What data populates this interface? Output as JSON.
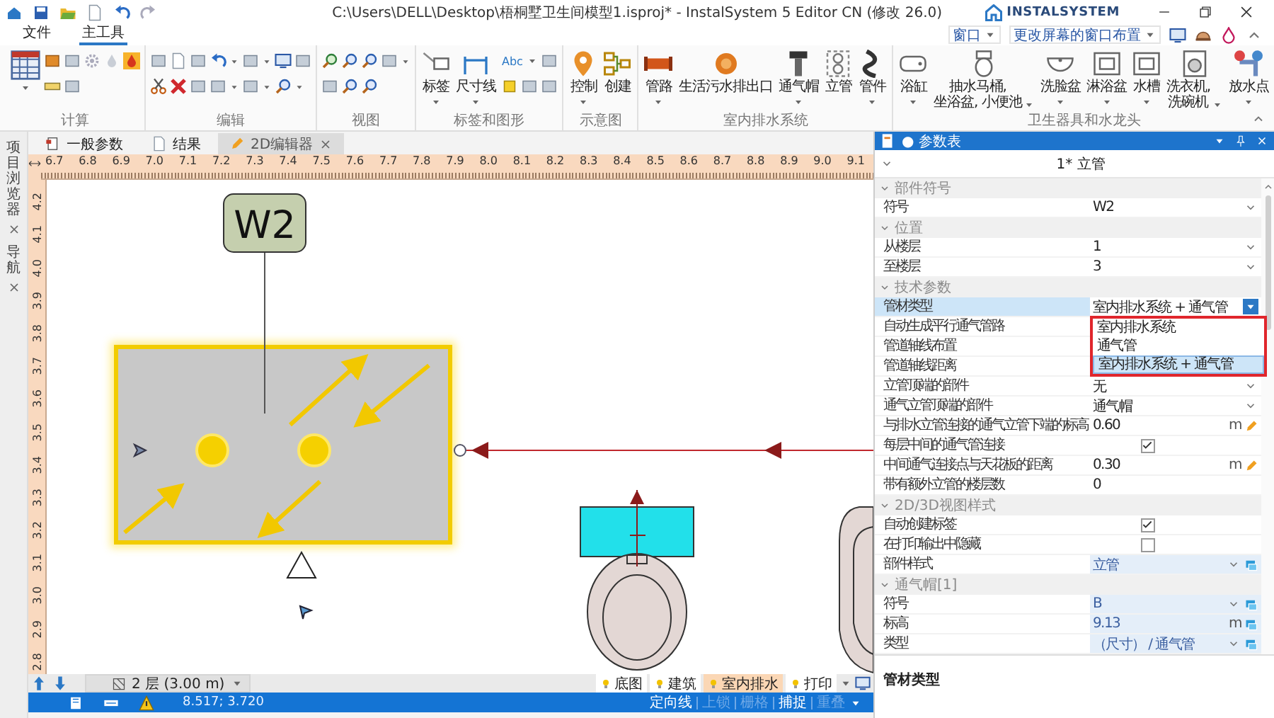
{
  "window": {
    "title": "C:\\Users\\DELL\\Desktop\\梧桐墅卫生间模型1.isproj* - InstalSystem 5 Editor CN (修改 26.0)",
    "logo": "INSTALSYSTEM"
  },
  "ribbon_tabs": [
    {
      "label": "文件",
      "selected": false
    },
    {
      "label": "主工具",
      "selected": true
    }
  ],
  "ribbon_right": [
    "窗口",
    "更改屏幕的窗口布置"
  ],
  "ribbon_groups": [
    {
      "label": "计算"
    },
    {
      "label": "编辑"
    },
    {
      "label": "视图"
    },
    {
      "label": "标签和图形",
      "text_tool": "Abc",
      "buttons": [
        {
          "label": "标签",
          "menu": true
        },
        {
          "label": "尺寸线",
          "menu": true
        }
      ]
    },
    {
      "label": "示意图",
      "buttons": [
        {
          "label": "控制",
          "menu": true
        },
        {
          "label": "创建",
          "menu": false
        }
      ]
    },
    {
      "label": "室内排水系统",
      "buttons": [
        {
          "label": "管路",
          "menu": true
        },
        {
          "label": "生活污水排出口",
          "menu": false
        },
        {
          "label": "通气帽",
          "menu": true
        },
        {
          "label": "立管",
          "menu": false
        },
        {
          "label": "管件",
          "menu": true
        }
      ]
    },
    {
      "label": "卫生器具和水龙头",
      "buttons": [
        {
          "label": "浴缸",
          "menu": true
        },
        {
          "label": "抽水马桶,\n坐浴盆, 小便池",
          "menu": true
        },
        {
          "label": "洗脸盆",
          "menu": true
        },
        {
          "label": "淋浴盆",
          "menu": true
        },
        {
          "label": "水槽",
          "menu": true
        },
        {
          "label": "洗衣机,\n洗碗机",
          "menu": true
        },
        {
          "label": "放水点",
          "menu": true
        }
      ]
    }
  ],
  "side_panels": [
    "项目浏览器",
    "导航"
  ],
  "doc_tabs": [
    {
      "label": "一般参数",
      "selected": false
    },
    {
      "label": "结果",
      "selected": false
    },
    {
      "label": "2D编辑器",
      "selected": true
    }
  ],
  "ruler": {
    "x_labels": [
      "6.7",
      "6.8",
      "6.9",
      "7.0",
      "7.1",
      "7.2",
      "7.3",
      "7.4",
      "7.5",
      "7.6",
      "7.7",
      "7.8",
      "7.9",
      "8.0",
      "8.1",
      "8.2",
      "8.3",
      "8.4",
      "8.5",
      "8.6",
      "8.7",
      "8.8",
      "8.9",
      "9.0",
      "9.1"
    ],
    "y_labels": [
      "4.2",
      "4.1",
      "4.0",
      "3.9",
      "3.8",
      "3.7",
      "3.6",
      "3.5",
      "3.4",
      "3.3",
      "3.2",
      "3.1",
      "3.0",
      "2.9",
      "2.8"
    ]
  },
  "canvas": {
    "tag": "W2"
  },
  "floor_bar": {
    "floor": "2 层 (3.00 m)",
    "layers": [
      {
        "label": "底图",
        "selected": false
      },
      {
        "label": "建筑",
        "selected": false
      },
      {
        "label": "室内排水",
        "selected": true
      },
      {
        "label": "打印",
        "selected": false
      }
    ]
  },
  "status_bar": {
    "coords": "8.517; 3.720",
    "toggles": [
      {
        "label": "定向线",
        "disabled": false
      },
      {
        "label": "上锁",
        "disabled": true
      },
      {
        "label": "栅格",
        "disabled": true
      },
      {
        "label": "捕捉",
        "disabled": false
      },
      {
        "label": "重叠",
        "disabled": true
      }
    ]
  },
  "properties": {
    "title": "● 参数表",
    "selection": "1* 立管",
    "groups": [
      {
        "label": "部件符号",
        "rows": [
          {
            "name": "符号",
            "value": "W2",
            "kind": "dropdown",
            "selected": false
          }
        ]
      },
      {
        "label": "位置",
        "rows": [
          {
            "name": "从楼层",
            "value": "1",
            "kind": "dropdown",
            "selected": false
          },
          {
            "name": "至楼层",
            "value": "3",
            "kind": "dropdown",
            "selected": false
          }
        ]
      },
      {
        "label": "技术参数",
        "rows": [
          {
            "name": "管材类型",
            "value": "室内排水系统 + 通气管",
            "kind": "dropdown",
            "selected": true,
            "options": [
              {
                "label": "室内排水系统",
                "selected": false
              },
              {
                "label": "通气管",
                "selected": false
              },
              {
                "label": "室内排水系统 + 通气管",
                "selected": true
              }
            ]
          },
          {
            "name": "自动生成平行通气管路",
            "kind": "text",
            "selected": false
          },
          {
            "name": "管道轴线布置",
            "kind": "text",
            "selected": false
          },
          {
            "name": "管道轴线距离",
            "kind": "text",
            "selected": false
          },
          {
            "name": "立管顶端的部件",
            "value": "无",
            "kind": "dropdown",
            "selected": false
          },
          {
            "name": "通气立管顶端的部件",
            "value": "通气帽",
            "kind": "dropdown",
            "selected": false
          },
          {
            "name": "与排水立管连接的通气立管下端的标高",
            "value": "0.60",
            "unit": "m",
            "kind": "unit",
            "selected": false
          },
          {
            "name": "每层中间的通气管连接",
            "kind": "check",
            "checked": true,
            "selected": false
          },
          {
            "name": "中间通气连接点与天花板的距离",
            "value": "0.30",
            "unit": "m",
            "kind": "unit",
            "selected": false
          },
          {
            "name": "带有额外立管的楼层数",
            "value": "0",
            "kind": "text",
            "selected": false
          }
        ]
      },
      {
        "label": "2D/3D视图样式",
        "rows": [
          {
            "name": "自动创建标签",
            "kind": "check",
            "checked": true,
            "selected": false
          },
          {
            "name": "在打印输出中隐藏",
            "kind": "check",
            "checked": false,
            "selected": false
          },
          {
            "name": "部件样式",
            "value": "立管",
            "kind": "linked-dropdown",
            "selected": false
          }
        ]
      },
      {
        "label": "通气帽[1]",
        "rows": [
          {
            "name": "符号",
            "value": "B",
            "kind": "linked-dropdown",
            "selected": false
          },
          {
            "name": "标高",
            "value": "9.13",
            "unit": "m",
            "kind": "linked-unit",
            "selected": false
          },
          {
            "name": "类型",
            "value": "（尺寸） / 通气管",
            "kind": "linked-dropdown",
            "selected": false
          }
        ]
      }
    ],
    "description": "管材类型"
  }
}
